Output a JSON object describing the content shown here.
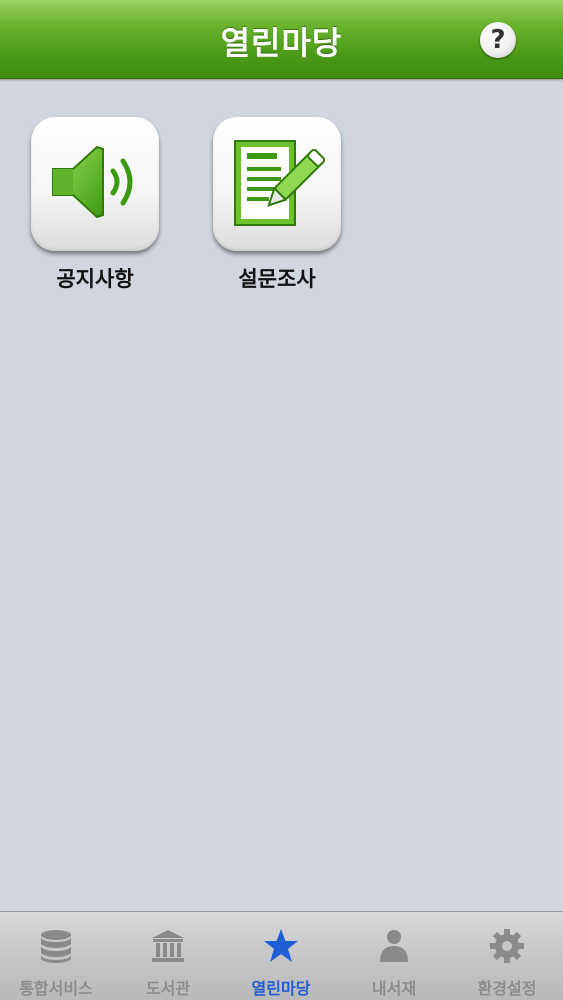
{
  "header": {
    "title": "열린마당",
    "help_label": "?"
  },
  "menu": {
    "items": [
      {
        "label": "공지사항",
        "icon": "speaker-icon"
      },
      {
        "label": "설문조사",
        "icon": "survey-icon"
      }
    ]
  },
  "tabbar": {
    "tabs": [
      {
        "label": "통합서비스",
        "icon": "database-icon",
        "active": false
      },
      {
        "label": "도서관",
        "icon": "library-icon",
        "active": false
      },
      {
        "label": "열린마당",
        "icon": "star-icon",
        "active": true
      },
      {
        "label": "내서재",
        "icon": "person-icon",
        "active": false
      },
      {
        "label": "환경설정",
        "icon": "gear-icon",
        "active": false
      }
    ]
  },
  "colors": {
    "header_green": "#4a9a16",
    "background": "#d1d6de",
    "active_tab": "#1f5ed6",
    "inactive_tab": "#8c8c8c"
  }
}
